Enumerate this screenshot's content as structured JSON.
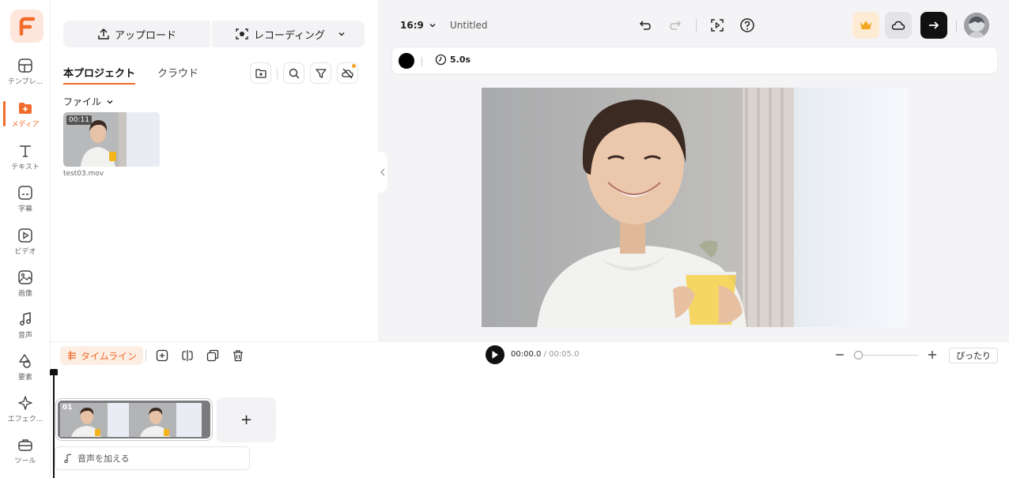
{
  "rail": {
    "items": [
      {
        "label": "テンプレ..."
      },
      {
        "label": "メディア"
      },
      {
        "label": "テキスト"
      },
      {
        "label": "字幕"
      },
      {
        "label": "ビデオ"
      },
      {
        "label": "画像"
      },
      {
        "label": "音声"
      },
      {
        "label": "要素"
      },
      {
        "label": "エフェク..."
      },
      {
        "label": "ツール"
      }
    ],
    "active_index": 1
  },
  "media": {
    "upload_label": "アップロード",
    "record_label": "レコーディング",
    "tabs": [
      {
        "label": "本プロジェクト",
        "active": true
      },
      {
        "label": "クラウド",
        "active": false
      }
    ],
    "filter_label": "ファイル",
    "files": [
      {
        "name": "test03.mov",
        "duration": "00:11"
      }
    ]
  },
  "preview": {
    "aspect_ratio": "16:9",
    "title": "Untitled",
    "background_color": "#000000",
    "clip_duration": "5.0s"
  },
  "timeline": {
    "label": "タイムライン",
    "current_time": "00:00.0",
    "total_time": " / 00:05.0",
    "fit_label": "ぴったり",
    "clip_index": "01",
    "add_audio_label": "音声を加える",
    "add_clip_symbol": "+"
  },
  "colors": {
    "accent": "#f26b2a",
    "dark": "#111111"
  }
}
